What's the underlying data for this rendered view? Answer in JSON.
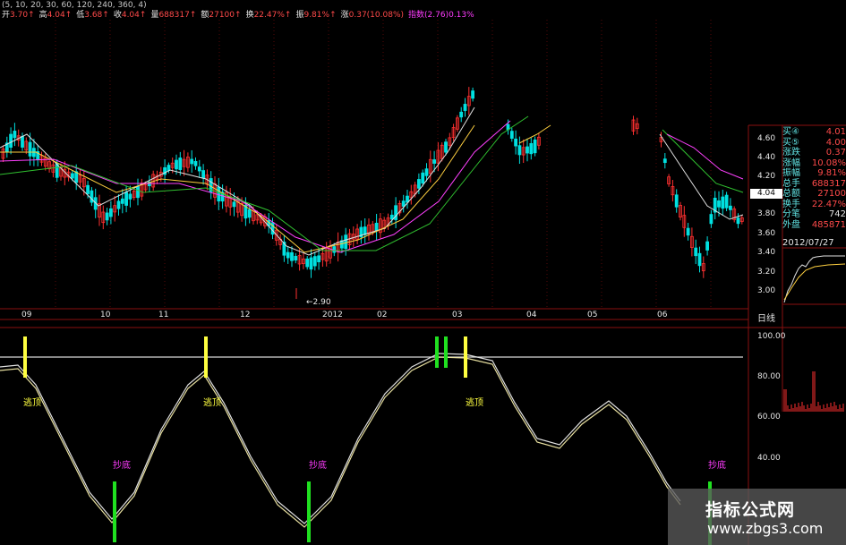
{
  "header": {
    "row1": "(5, 10, 20, 30, 60, 120, 240, 360, 4)",
    "row2": [
      {
        "label": "开",
        "value": "3.70",
        "arrow": "↑"
      },
      {
        "label": "高",
        "value": "4.04",
        "arrow": "↑"
      },
      {
        "label": "低",
        "value": "3.68",
        "arrow": "↑"
      },
      {
        "label": "收",
        "value": "4.04",
        "arrow": "↑"
      },
      {
        "label": "量",
        "value": "688317",
        "arrow": "↑"
      },
      {
        "label": "额",
        "value": "27100",
        "arrow": "↑"
      },
      {
        "label": "换",
        "value": "22.47%",
        "arrow": "↑"
      },
      {
        "label": "振",
        "value": "9.81%",
        "arrow": "↑"
      },
      {
        "label": "涨",
        "value": "0.37(10.08%)",
        "arrow": ""
      },
      {
        "label": "指数",
        "value": "(2.76)0.13%",
        "arrow": ""
      }
    ]
  },
  "right_panel": {
    "rows": [
      {
        "label": "买④",
        "value": "4.01"
      },
      {
        "label": "买⑤",
        "value": "4.00"
      },
      {
        "label": "涨跌",
        "value": "0.37"
      },
      {
        "label": "涨幅",
        "value": "10.08%"
      },
      {
        "label": "振幅",
        "value": "9.81%"
      },
      {
        "label": "总手",
        "value": "688317"
      },
      {
        "label": "总额",
        "value": "27100"
      },
      {
        "label": "换手",
        "value": "22.47%"
      },
      {
        "label": "分笔",
        "value": "742"
      },
      {
        "label": "外盘",
        "value": "485871"
      }
    ],
    "date": "2012/07/27"
  },
  "price_axis": [
    "4.60",
    "4.40",
    "4.20",
    "4.00",
    "3.80",
    "3.60",
    "3.40",
    "3.20",
    "3.00"
  ],
  "current_price": "4.04",
  "low_marker": "2.90",
  "date_axis": [
    "09",
    "10",
    "11",
    "12",
    "2012",
    "02",
    "03",
    "04",
    "05",
    "06"
  ],
  "period_label": "日线",
  "indicator_axis": [
    "100.00",
    "80.00",
    "60.00",
    "40.00"
  ],
  "signals": {
    "escape": "逃顶",
    "bottom": "抄底"
  },
  "watermark": {
    "title": "指标公式网",
    "url": "www.zbgs3.com"
  },
  "colors": {
    "up": "#ff3030",
    "down": "#00e0e0",
    "grid": "#8a1010",
    "label_cyan": "#60e0e0",
    "signal_yellow": "#ffff40",
    "signal_green": "#20e020",
    "signal_magenta": "#ff3cff"
  }
}
